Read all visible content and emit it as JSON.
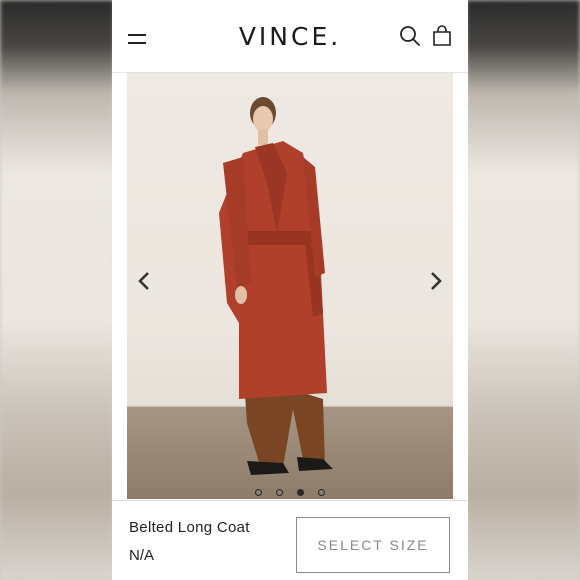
{
  "header": {
    "logo": "VINCE.",
    "icons": [
      "menu-icon",
      "search-icon",
      "shopping-bag-icon"
    ]
  },
  "gallery": {
    "slide_count": 4,
    "active_slide": 3,
    "arrows": [
      "chevron-left-icon",
      "chevron-right-icon"
    ]
  },
  "product": {
    "name": "Belted Long Coat",
    "price": "N/A",
    "select_size_label": "SELECT SIZE"
  },
  "colors": {
    "coat": "#b0402c",
    "trousers": "#7a4524",
    "backdrop": "#ece6df",
    "text": "#222222",
    "button_border": "#8a8a8a"
  }
}
